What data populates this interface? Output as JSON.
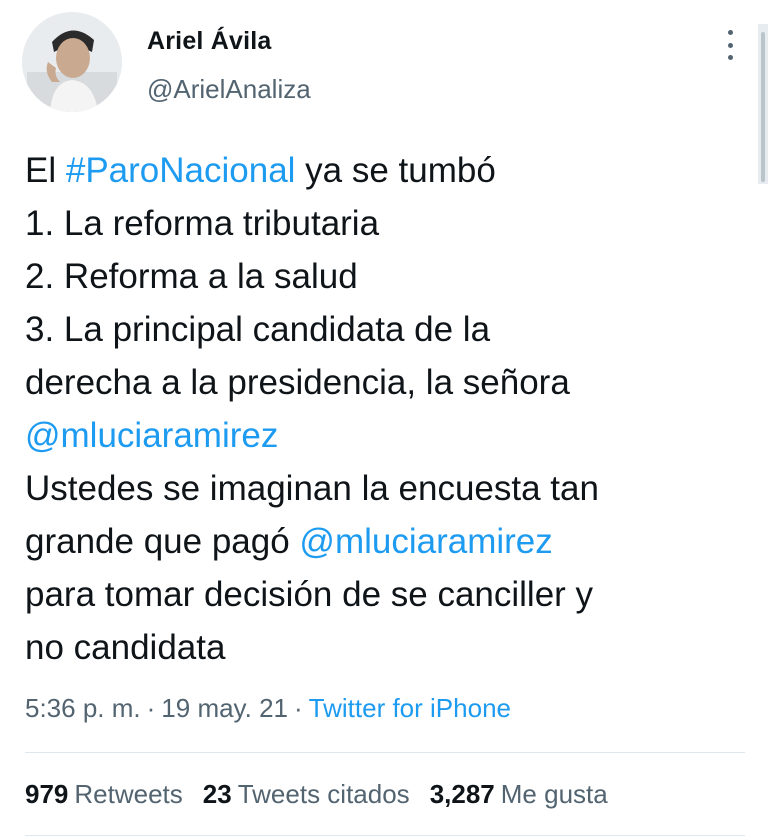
{
  "author": {
    "display_name": "Ariel Ávila",
    "handle": "@ArielAnaliza"
  },
  "tweet": {
    "lines": [
      [
        {
          "text": "El "
        },
        {
          "text": "#ParoNacional",
          "link": true
        },
        {
          "text": " ya se tumbó"
        }
      ],
      [
        {
          "text": "1. La reforma tributaria"
        }
      ],
      [
        {
          "text": "2. Reforma a la salud"
        }
      ],
      [
        {
          "text": "3. La principal candidata de la"
        }
      ],
      [
        {
          "text": "derecha a la presidencia, la señora"
        }
      ],
      [
        {
          "text": "@mluciaramirez",
          "link": true
        }
      ],
      [
        {
          "text": "Ustedes se imaginan la encuesta tan"
        }
      ],
      [
        {
          "text": "grande que pagó "
        },
        {
          "text": "@mluciaramirez",
          "link": true
        }
      ],
      [
        {
          "text": "para tomar decisión de se canciller y"
        }
      ],
      [
        {
          "text": "no candidata"
        }
      ]
    ]
  },
  "meta": {
    "time": "5:36 p. m.",
    "separator": "·",
    "date": "19 may. 21",
    "source": "Twitter for iPhone"
  },
  "stats": {
    "retweets_count": "979",
    "retweets_label": "Retweets",
    "quotes_count": "23",
    "quotes_label": "Tweets citados",
    "likes_count": "3,287",
    "likes_label": "Me gusta"
  },
  "colors": {
    "link": "#1d9bf0",
    "secondary_text": "#536471",
    "primary_text": "#0f1419"
  },
  "icons": {
    "more": "more-vertical-icon"
  }
}
